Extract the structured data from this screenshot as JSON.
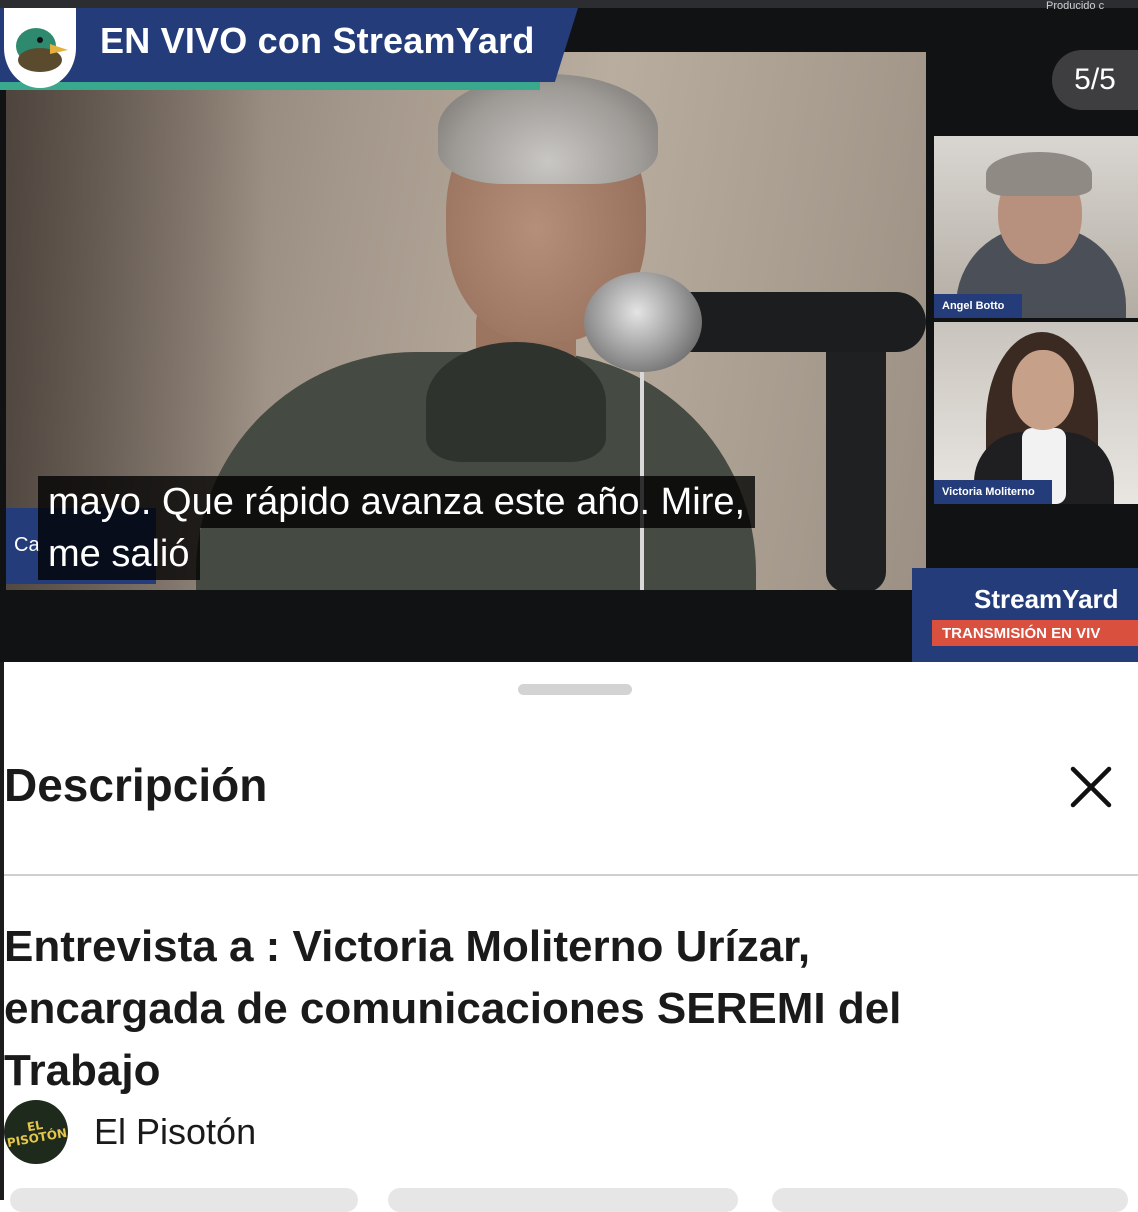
{
  "video": {
    "banner_text": "EN VIVO con StreamYard",
    "page_counter": "5/5",
    "producer_text": "Producido c",
    "side_tiles": [
      {
        "label": "Angel Botto"
      },
      {
        "label": "Victoria Moliterno"
      }
    ],
    "captions": [
      "mayo. Que rápido avanza este año. Mire,",
      "me salió"
    ],
    "host_name_partial": "Ca",
    "corner_brand": "StreamYard",
    "corner_badge": "TRANSMISIÓN EN VIV",
    "colors": {
      "brand_blue": "#243d7a",
      "brand_green": "#3aa88c",
      "badge_red": "#d9503f"
    }
  },
  "sheet": {
    "title": "Descripción",
    "close_icon": "close-icon",
    "headline_lines": [
      "Entrevista a : Victoria Moliterno Urízar,",
      "encargada de comunicaciones SEREMI del",
      "Trabajo"
    ],
    "channel": {
      "name": "El Pisotón",
      "avatar_text": "EL PISOTÓN"
    }
  }
}
